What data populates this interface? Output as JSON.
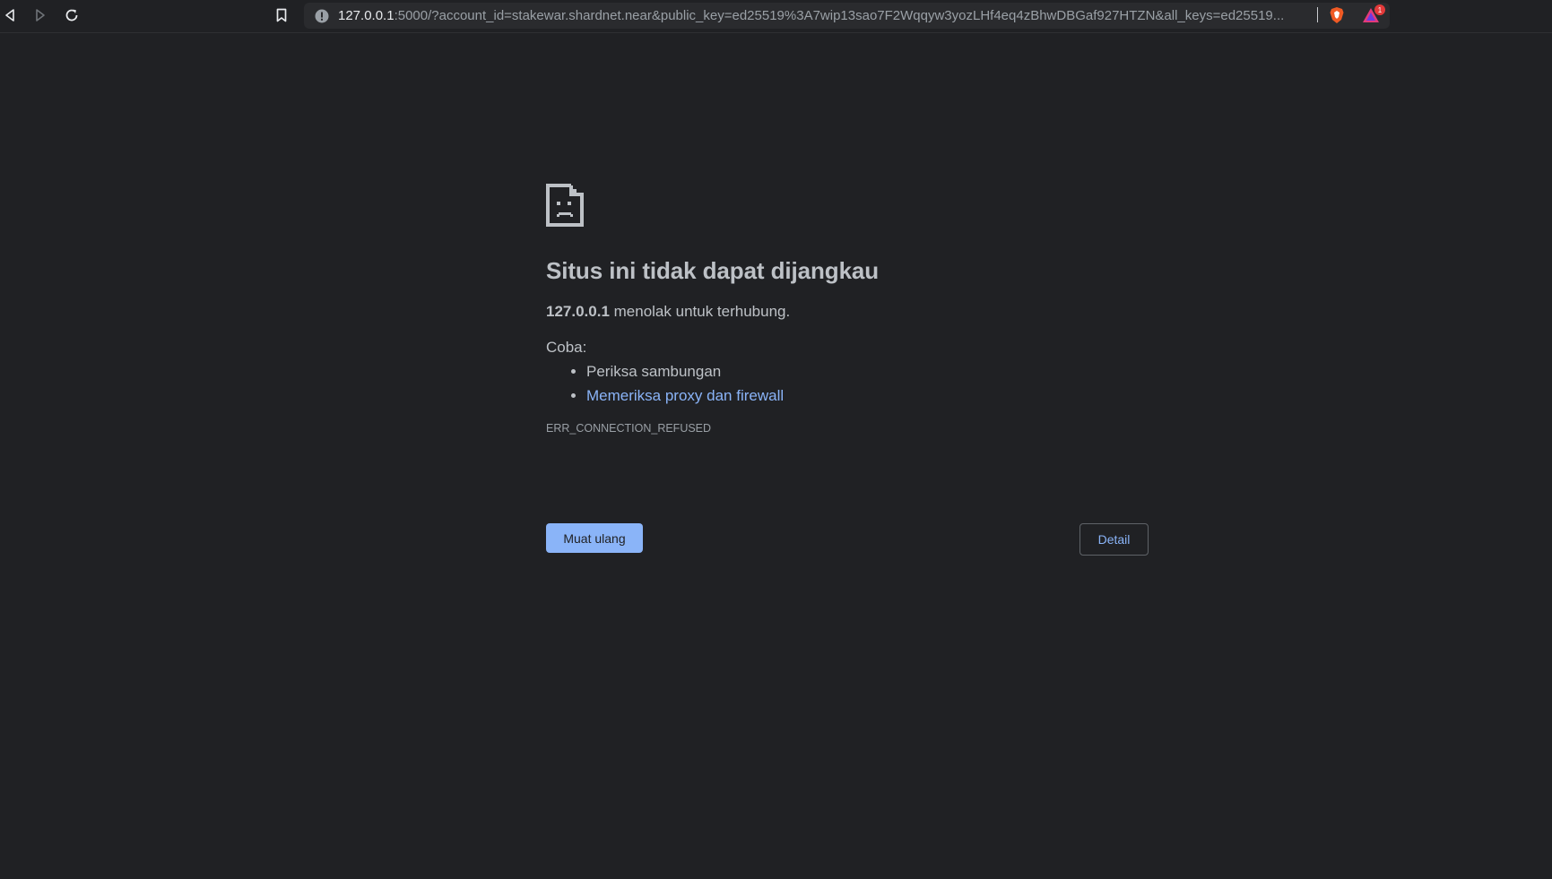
{
  "browser": {
    "url_host": "127.0.0.1",
    "url_rest": ":5000/?account_id=stakewar.shardnet.near&public_key=ed25519%3A7wip13sao7F2Wqqyw3yozLHf4eq4zBhwDBGaf927HTZN&all_keys=ed25519...",
    "rewards_badge_count": "1",
    "icons": [
      "back-icon",
      "forward-icon",
      "reload-icon",
      "bookmark-icon",
      "site-info-icon",
      "brave-shields-icon",
      "brave-rewards-icon"
    ]
  },
  "error_page": {
    "icon": "sad-document-icon",
    "title": "Situs ini tidak dapat dijangkau",
    "host": "127.0.0.1",
    "summary_rest": " menolak untuk terhubung.",
    "try_label": "Coba:",
    "suggestions": [
      "Periksa sambungan",
      "Memeriksa proxy dan firewall"
    ],
    "error_code": "ERR_CONNECTION_REFUSED",
    "reload_label": "Muat ulang",
    "details_label": "Detail"
  },
  "colors": {
    "background": "#202124",
    "text": "#bdc1c6",
    "link": "#8ab4f8",
    "primary_button": "#8ab4f8"
  }
}
